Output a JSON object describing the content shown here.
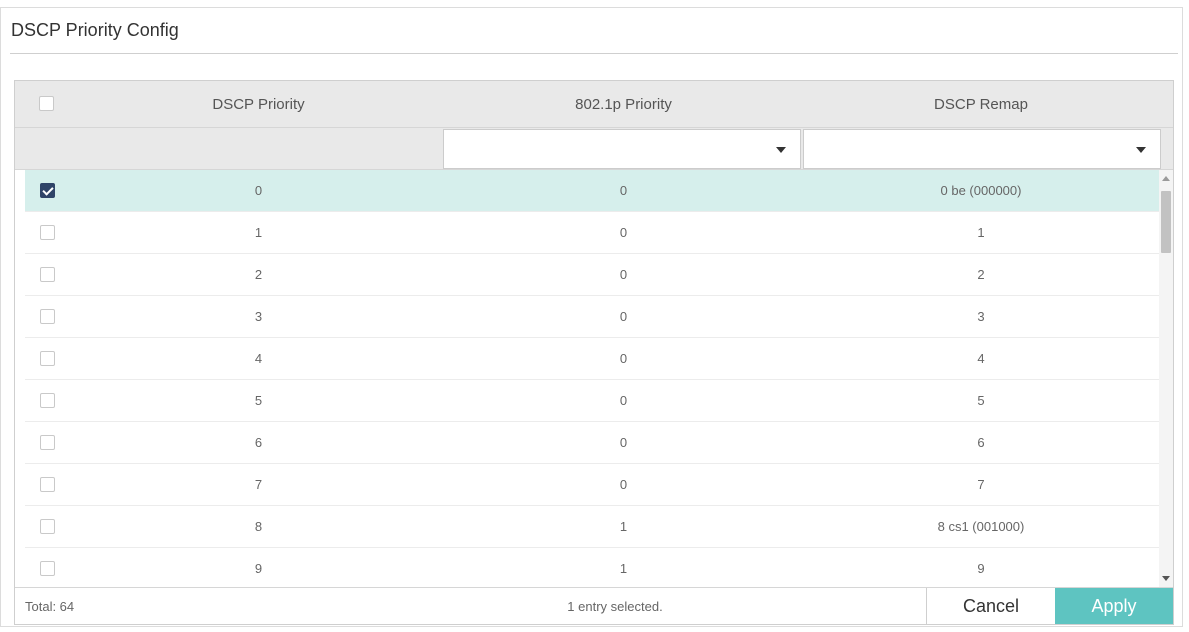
{
  "panel": {
    "title": "DSCP Priority Config"
  },
  "table": {
    "columns": [
      "DSCP Priority",
      "802.1p Priority",
      "DSCP Remap"
    ],
    "filters": {
      "priority_8021p": "",
      "dscp_remap": ""
    },
    "rows": [
      {
        "dscp": "0",
        "p8021": "0",
        "remap": "0 be (000000)",
        "checked": true
      },
      {
        "dscp": "1",
        "p8021": "0",
        "remap": "1",
        "checked": false
      },
      {
        "dscp": "2",
        "p8021": "0",
        "remap": "2",
        "checked": false
      },
      {
        "dscp": "3",
        "p8021": "0",
        "remap": "3",
        "checked": false
      },
      {
        "dscp": "4",
        "p8021": "0",
        "remap": "4",
        "checked": false
      },
      {
        "dscp": "5",
        "p8021": "0",
        "remap": "5",
        "checked": false
      },
      {
        "dscp": "6",
        "p8021": "0",
        "remap": "6",
        "checked": false
      },
      {
        "dscp": "7",
        "p8021": "0",
        "remap": "7",
        "checked": false
      },
      {
        "dscp": "8",
        "p8021": "1",
        "remap": "8 cs1 (001000)",
        "checked": false
      },
      {
        "dscp": "9",
        "p8021": "1",
        "remap": "9",
        "checked": false
      }
    ]
  },
  "footer": {
    "total": "Total: 64",
    "selected_info": "1 entry selected.",
    "cancel_label": "Cancel",
    "apply_label": "Apply"
  },
  "colors": {
    "selected_row": "#d6efec",
    "checkbox_checked": "#2f4468",
    "apply_button": "#5ec4c1"
  }
}
